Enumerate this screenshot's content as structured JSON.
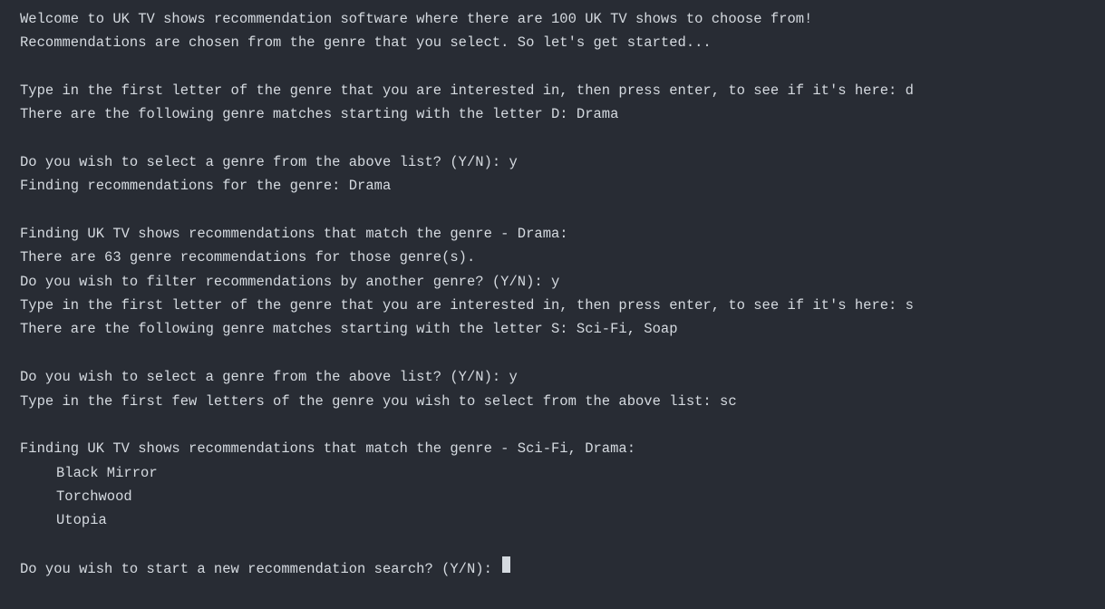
{
  "lines": {
    "welcome1": "Welcome to UK TV shows recommendation software where there are 100 UK TV shows to choose from!",
    "welcome2": "Recommendations are chosen from the genre that you select. So let's get started...",
    "prompt_first_letter1": "Type in the first letter of the genre that you are interested in, then press enter, to see if it's here: d",
    "matches_d": "There are the following genre matches starting with the letter D: Drama",
    "select_genre1": "Do you wish to select a genre from the above list? (Y/N): y",
    "finding_rec_genre": "Finding recommendations for the genre: Drama",
    "finding_match1": "Finding UK TV shows recommendations that match the genre - Drama:",
    "count_msg": "There are 63 genre recommendations for those genre(s).",
    "filter_another": "Do you wish to filter recommendations by another genre? (Y/N): y",
    "prompt_first_letter2": "Type in the first letter of the genre that you are interested in, then press enter, to see if it's here: s",
    "matches_s": "There are the following genre matches starting with the letter S: Sci-Fi, Soap",
    "select_genre2": "Do you wish to select a genre from the above list? (Y/N): y",
    "type_few_letters": "Type in the first few letters of the genre you wish to select from the above list: sc",
    "finding_match2": "Finding UK TV shows recommendations that match the genre - Sci-Fi, Drama:",
    "result1": "Black Mirror",
    "result2": "Torchwood",
    "result3": "Utopia",
    "new_search_prompt": "Do you wish to start a new recommendation search? (Y/N): "
  }
}
